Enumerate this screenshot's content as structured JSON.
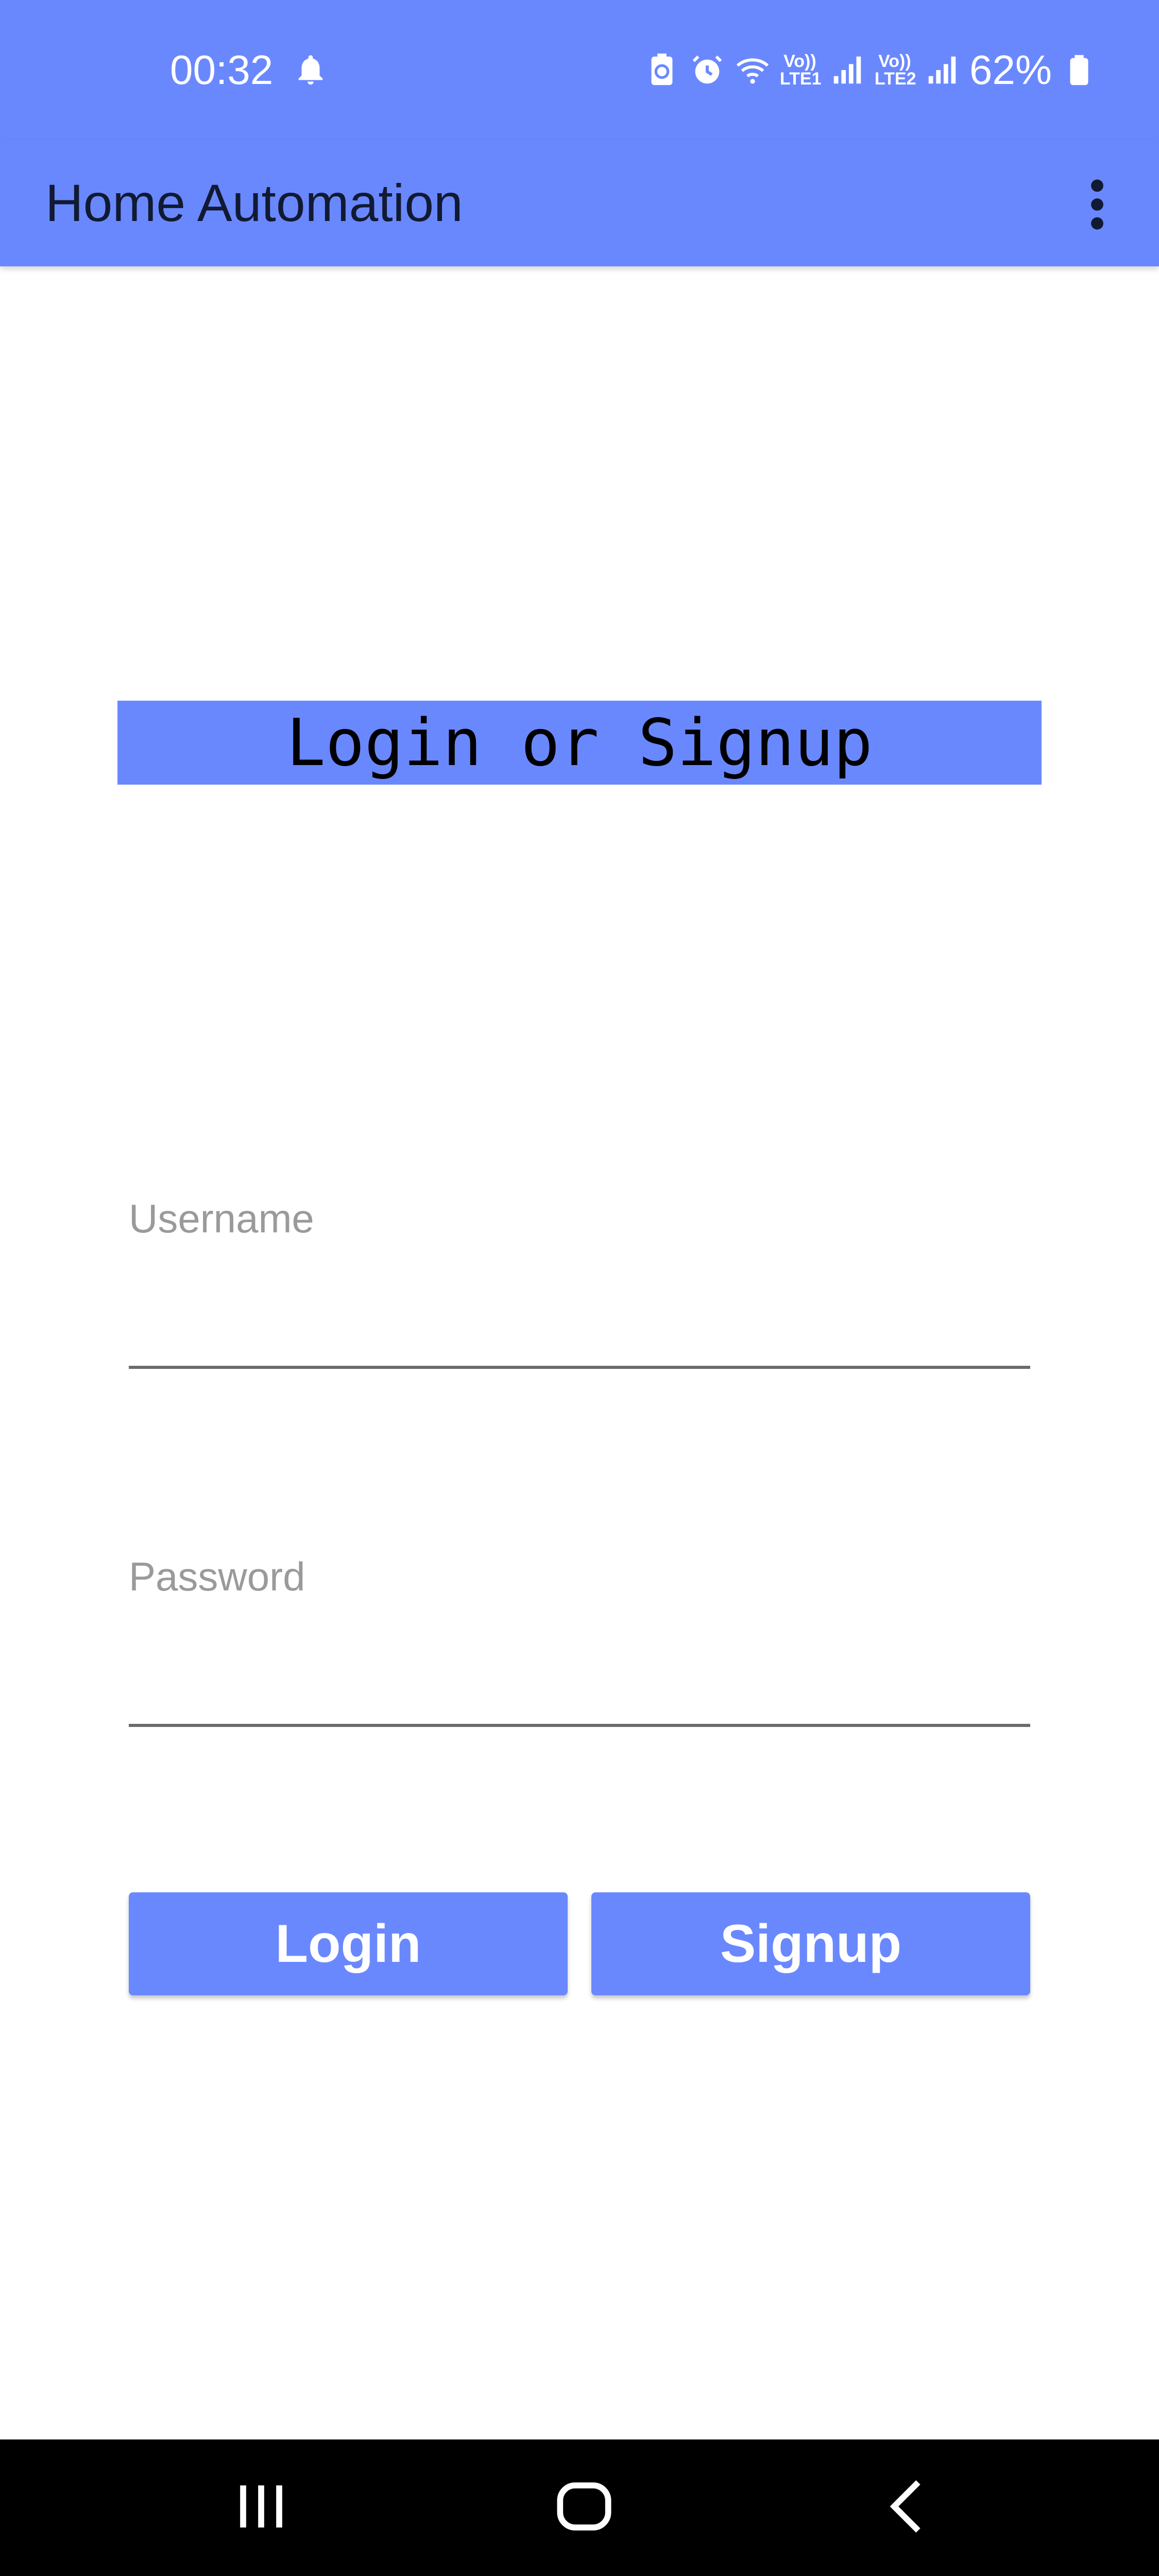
{
  "status_bar": {
    "time": "00:32",
    "battery": "62%",
    "sim1": [
      "Vo))",
      "LTE1"
    ],
    "sim2": [
      "Vo))",
      "LTE2"
    ],
    "icons": [
      "bell-icon",
      "battery-saver-icon",
      "alarm-icon",
      "wifi-icon",
      "signal-icon",
      "signal-icon",
      "battery-icon"
    ]
  },
  "app_bar": {
    "title": "Home Automation",
    "menu_icon": "more-vert-icon"
  },
  "main": {
    "heading": "Login or Signup",
    "username": {
      "label": "Username",
      "value": ""
    },
    "password": {
      "label": "Password",
      "value": ""
    },
    "login_button": "Login",
    "signup_button": "Signup"
  },
  "nav_bar": {
    "icons": [
      "recent-apps-icon",
      "home-icon",
      "back-icon"
    ]
  },
  "colors": {
    "accent": "#6a88fe",
    "title_text": "#111a33",
    "label_text": "#9a9a9a",
    "nav_background": "#000000"
  }
}
